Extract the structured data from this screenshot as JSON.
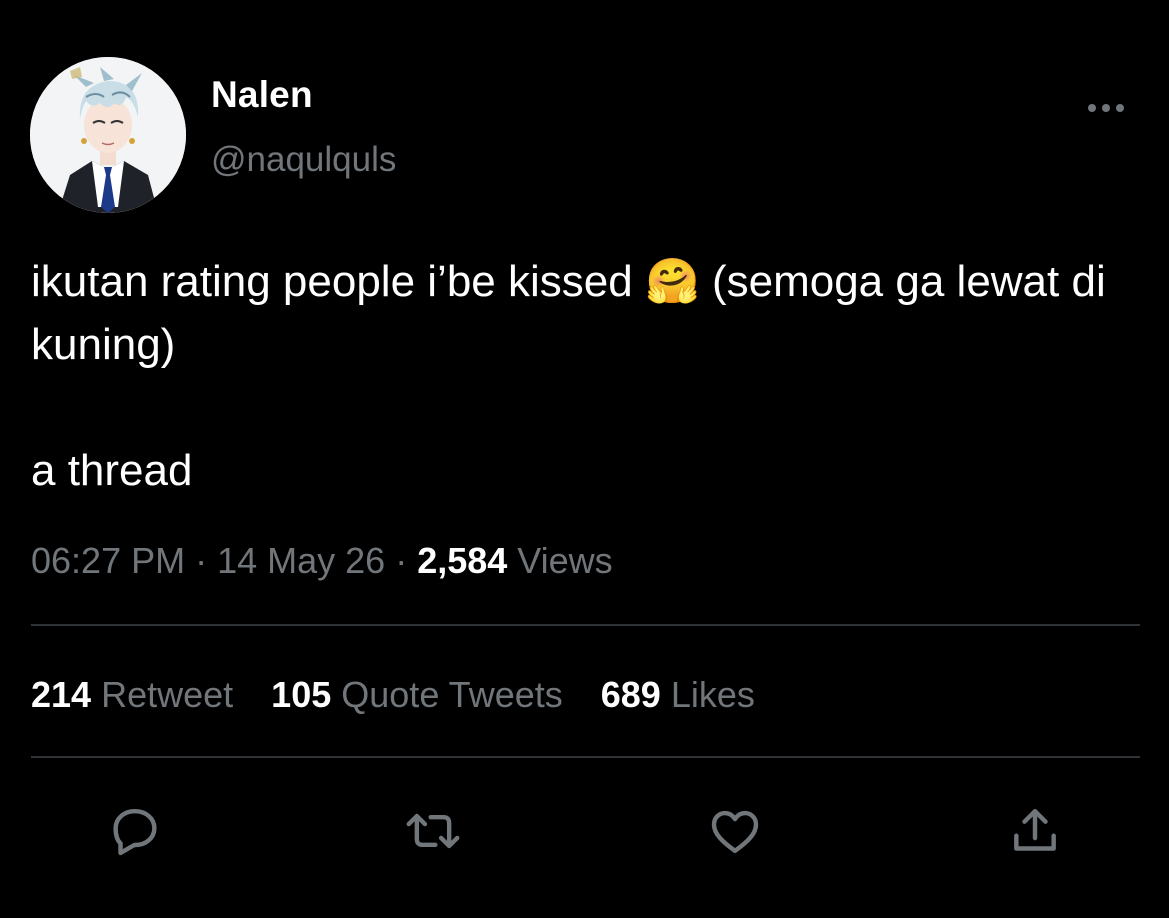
{
  "user": {
    "display_name": "Nalen",
    "handle": "@naqulquls",
    "avatar_icon": "anime-avatar-icon"
  },
  "tweet": {
    "line1_text": "ikutan rating people i’be kissed ",
    "emoji": "🤗",
    "line1_tail": "  (semoga ga lewat di kuning)",
    "line2": "a thread"
  },
  "meta": {
    "time": "06:27 PM",
    "sep1": " · ",
    "date": "14 May 26",
    "sep2": " · ",
    "views_count": "2,584",
    "views_label": " Views"
  },
  "stats": {
    "retweets_count": "214",
    "retweets_label": "Retweet",
    "quotes_count": "105",
    "quotes_label": "Quote Tweets",
    "likes_count": "689",
    "likes_label": "Likes"
  },
  "actions": [
    {
      "name": "reply",
      "icon": "reply-icon"
    },
    {
      "name": "retweet",
      "icon": "retweet-icon"
    },
    {
      "name": "like",
      "icon": "heart-icon"
    },
    {
      "name": "share",
      "icon": "share-icon"
    }
  ],
  "colors": {
    "background": "#000000",
    "primary_text": "#ffffff",
    "secondary_text": "#71767b",
    "divider": "#2f3336",
    "icon": "#71767b"
  }
}
